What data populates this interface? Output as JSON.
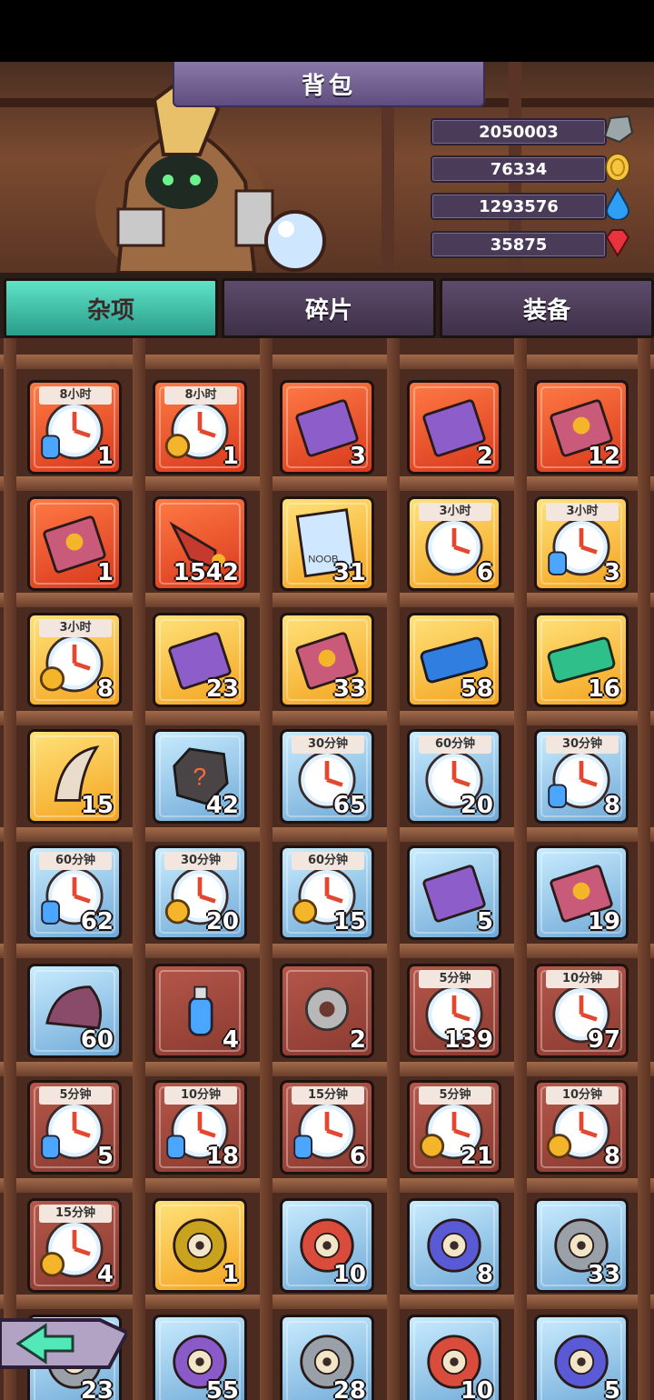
{
  "title": "背包",
  "currencies": [
    {
      "value": "2050003",
      "icon": "stone-icon"
    },
    {
      "value": "76334",
      "icon": "gold-coin-icon"
    },
    {
      "value": "1293576",
      "icon": "water-drop-icon"
    },
    {
      "value": "35875",
      "icon": "red-gem-icon"
    }
  ],
  "tabs": [
    {
      "label": "杂项",
      "active": true
    },
    {
      "label": "碎片",
      "active": false
    },
    {
      "label": "装备",
      "active": false
    }
  ],
  "items": [
    [
      {
        "bg": "red",
        "icon": "clock-potion",
        "tag": "8小时",
        "qty": "1"
      },
      {
        "bg": "red",
        "icon": "clock-gear",
        "tag": "8小时",
        "qty": "1"
      },
      {
        "bg": "red",
        "icon": "purple-book",
        "tag": "",
        "qty": "3"
      },
      {
        "bg": "red",
        "icon": "purple-book",
        "tag": "",
        "qty": "2"
      },
      {
        "bg": "red",
        "icon": "pink-book",
        "tag": "",
        "qty": "12"
      }
    ],
    [
      {
        "bg": "red",
        "icon": "pink-book",
        "tag": "",
        "qty": "1"
      },
      {
        "bg": "red",
        "icon": "horn",
        "tag": "",
        "qty": "1542"
      },
      {
        "bg": "gold",
        "icon": "poster",
        "tag": "",
        "qty": "31"
      },
      {
        "bg": "gold",
        "icon": "clock",
        "tag": "3小时",
        "qty": "6"
      },
      {
        "bg": "gold",
        "icon": "clock-potion",
        "tag": "3小时",
        "qty": "3"
      }
    ],
    [
      {
        "bg": "gold",
        "icon": "clock-gear",
        "tag": "3小时",
        "qty": "8"
      },
      {
        "bg": "gold",
        "icon": "purple-book",
        "tag": "",
        "qty": "23"
      },
      {
        "bg": "gold",
        "icon": "pink-book",
        "tag": "",
        "qty": "33"
      },
      {
        "bg": "gold",
        "icon": "blue-ticket",
        "tag": "",
        "qty": "58"
      },
      {
        "bg": "gold",
        "icon": "green-ticket",
        "tag": "",
        "qty": "16"
      }
    ],
    [
      {
        "bg": "gold",
        "icon": "claw",
        "tag": "",
        "qty": "15"
      },
      {
        "bg": "blue",
        "icon": "mystery-stone",
        "tag": "",
        "qty": "42"
      },
      {
        "bg": "blue",
        "icon": "clock",
        "tag": "30分钟",
        "qty": "65"
      },
      {
        "bg": "blue",
        "icon": "clock",
        "tag": "60分钟",
        "qty": "20"
      },
      {
        "bg": "blue",
        "icon": "clock-potion",
        "tag": "30分钟",
        "qty": "8"
      }
    ],
    [
      {
        "bg": "blue",
        "icon": "clock-potion",
        "tag": "60分钟",
        "qty": "62"
      },
      {
        "bg": "blue",
        "icon": "clock-gear",
        "tag": "30分钟",
        "qty": "20"
      },
      {
        "bg": "blue",
        "icon": "clock-gear",
        "tag": "60分钟",
        "qty": "15"
      },
      {
        "bg": "blue",
        "icon": "purple-book",
        "tag": "",
        "qty": "5"
      },
      {
        "bg": "blue",
        "icon": "pink-book",
        "tag": "",
        "qty": "19"
      }
    ],
    [
      {
        "bg": "blue",
        "icon": "shell",
        "tag": "",
        "qty": "60"
      },
      {
        "bg": "brown",
        "icon": "potion",
        "tag": "",
        "qty": "4"
      },
      {
        "bg": "brown",
        "icon": "gear",
        "tag": "",
        "qty": "2"
      },
      {
        "bg": "brown",
        "icon": "clock",
        "tag": "5分钟",
        "qty": "139"
      },
      {
        "bg": "brown",
        "icon": "clock",
        "tag": "10分钟",
        "qty": "97"
      }
    ],
    [
      {
        "bg": "brown",
        "icon": "clock-potion",
        "tag": "5分钟",
        "qty": "5"
      },
      {
        "bg": "brown",
        "icon": "clock-potion",
        "tag": "10分钟",
        "qty": "18"
      },
      {
        "bg": "brown",
        "icon": "clock-potion",
        "tag": "15分钟",
        "qty": "6"
      },
      {
        "bg": "brown",
        "icon": "clock-gear",
        "tag": "5分钟",
        "qty": "21"
      },
      {
        "bg": "brown",
        "icon": "clock-gear",
        "tag": "10分钟",
        "qty": "8"
      }
    ],
    [
      {
        "bg": "brown",
        "icon": "clock-gear",
        "tag": "15分钟",
        "qty": "4"
      },
      {
        "bg": "gold",
        "icon": "emblem",
        "tag": "",
        "qty": "1"
      },
      {
        "bg": "blue",
        "icon": "emblem-red",
        "tag": "",
        "qty": "10"
      },
      {
        "bg": "blue",
        "icon": "emblem-blue",
        "tag": "",
        "qty": "8"
      },
      {
        "bg": "blue",
        "icon": "emblem-gray",
        "tag": "",
        "qty": "33"
      }
    ],
    [
      {
        "bg": "blue",
        "icon": "emblem-gray",
        "tag": "",
        "qty": "23"
      },
      {
        "bg": "blue",
        "icon": "emblem-purple",
        "tag": "",
        "qty": "55"
      },
      {
        "bg": "blue",
        "icon": "emblem-gray",
        "tag": "",
        "qty": "28"
      },
      {
        "bg": "blue",
        "icon": "emblem-red",
        "tag": "",
        "qty": "10"
      },
      {
        "bg": "blue",
        "icon": "emblem-blue",
        "tag": "",
        "qty": "5"
      }
    ]
  ],
  "back_icon": "back-arrow-icon",
  "colors": {
    "tab_active": "#3ec7ad",
    "tab_inactive": "#4f3d5b",
    "shelf": "#4b2a20"
  }
}
